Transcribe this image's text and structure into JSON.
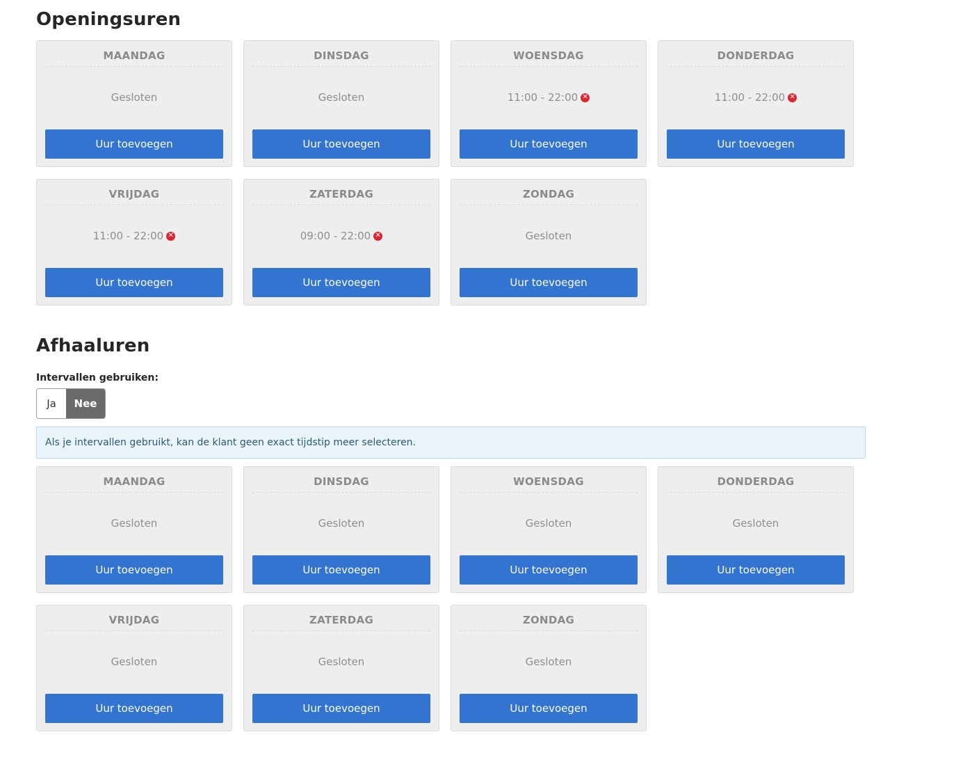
{
  "opening": {
    "title": "Openingsuren",
    "days": [
      {
        "day": "MAANDAG",
        "status": "Gesloten",
        "closed": true
      },
      {
        "day": "DINSDAG",
        "status": "Gesloten",
        "closed": true
      },
      {
        "day": "WOENSDAG",
        "status": "11:00 - 22:00",
        "closed": false
      },
      {
        "day": "DONDERDAG",
        "status": "11:00 - 22:00",
        "closed": false
      },
      {
        "day": "VRIJDAG",
        "status": "11:00 - 22:00",
        "closed": false
      },
      {
        "day": "ZATERDAG",
        "status": "09:00 - 22:00",
        "closed": false
      },
      {
        "day": "ZONDAG",
        "status": "Gesloten",
        "closed": true
      }
    ]
  },
  "pickup": {
    "title": "Afhaaluren",
    "interval_label": "Intervallen gebruiken:",
    "toggle": {
      "yes": "Ja",
      "no": "Nee",
      "selected": "Nee"
    },
    "info": "Als je intervallen gebruikt, kan de klant geen exact tijdstip meer selecteren.",
    "days": [
      {
        "day": "MAANDAG",
        "status": "Gesloten",
        "closed": true
      },
      {
        "day": "DINSDAG",
        "status": "Gesloten",
        "closed": true
      },
      {
        "day": "WOENSDAG",
        "status": "Gesloten",
        "closed": true
      },
      {
        "day": "DONDERDAG",
        "status": "Gesloten",
        "closed": true
      },
      {
        "day": "VRIJDAG",
        "status": "Gesloten",
        "closed": true
      },
      {
        "day": "ZATERDAG",
        "status": "Gesloten",
        "closed": true
      },
      {
        "day": "ZONDAG",
        "status": "Gesloten",
        "closed": true
      }
    ]
  },
  "add_button_label": "Uur toevoegen",
  "colors": {
    "button": "#3274d0",
    "remove": "#d9262f",
    "info_bg": "#e9f4fb",
    "toggle_selected": "#6a6a6a"
  },
  "icons": {
    "remove": "times-circle-icon"
  }
}
